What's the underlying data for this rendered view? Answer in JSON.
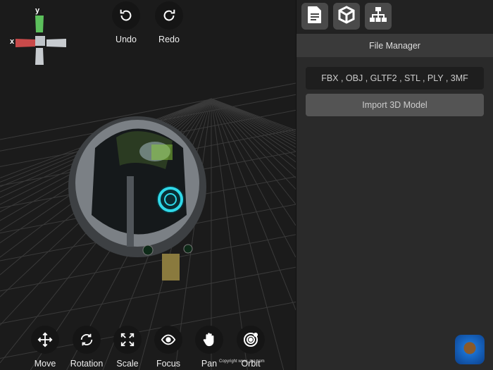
{
  "viewport": {
    "axes": {
      "x_label": "x",
      "y_label": "y"
    },
    "top_tools": [
      {
        "label": "Undo",
        "icon": "undo-icon"
      },
      {
        "label": "Redo",
        "icon": "redo-icon"
      }
    ],
    "bottom_tools": [
      {
        "label": "Move",
        "icon": "move-icon"
      },
      {
        "label": "Rotation",
        "icon": "rotate-icon"
      },
      {
        "label": "Scale",
        "icon": "scale-icon"
      },
      {
        "label": "Focus",
        "icon": "eye-icon"
      },
      {
        "label": "Pan",
        "icon": "hand-icon"
      },
      {
        "label": "Orbit",
        "icon": "orbit-icon"
      }
    ],
    "copyright": "Copyright www.        me.com"
  },
  "panel": {
    "tabs": [
      {
        "icon": "file-icon"
      },
      {
        "icon": "cube-icon"
      },
      {
        "icon": "hierarchy-icon"
      }
    ],
    "title": "File Manager",
    "formats": "FBX , OBJ , GLTF2 , STL , PLY , 3MF",
    "import_label": "Import 3D Model"
  },
  "colors": {
    "x_axis": "#c84a4a",
    "y_axis": "#5cc05c",
    "accent_cyan": "#2fd8e8"
  }
}
